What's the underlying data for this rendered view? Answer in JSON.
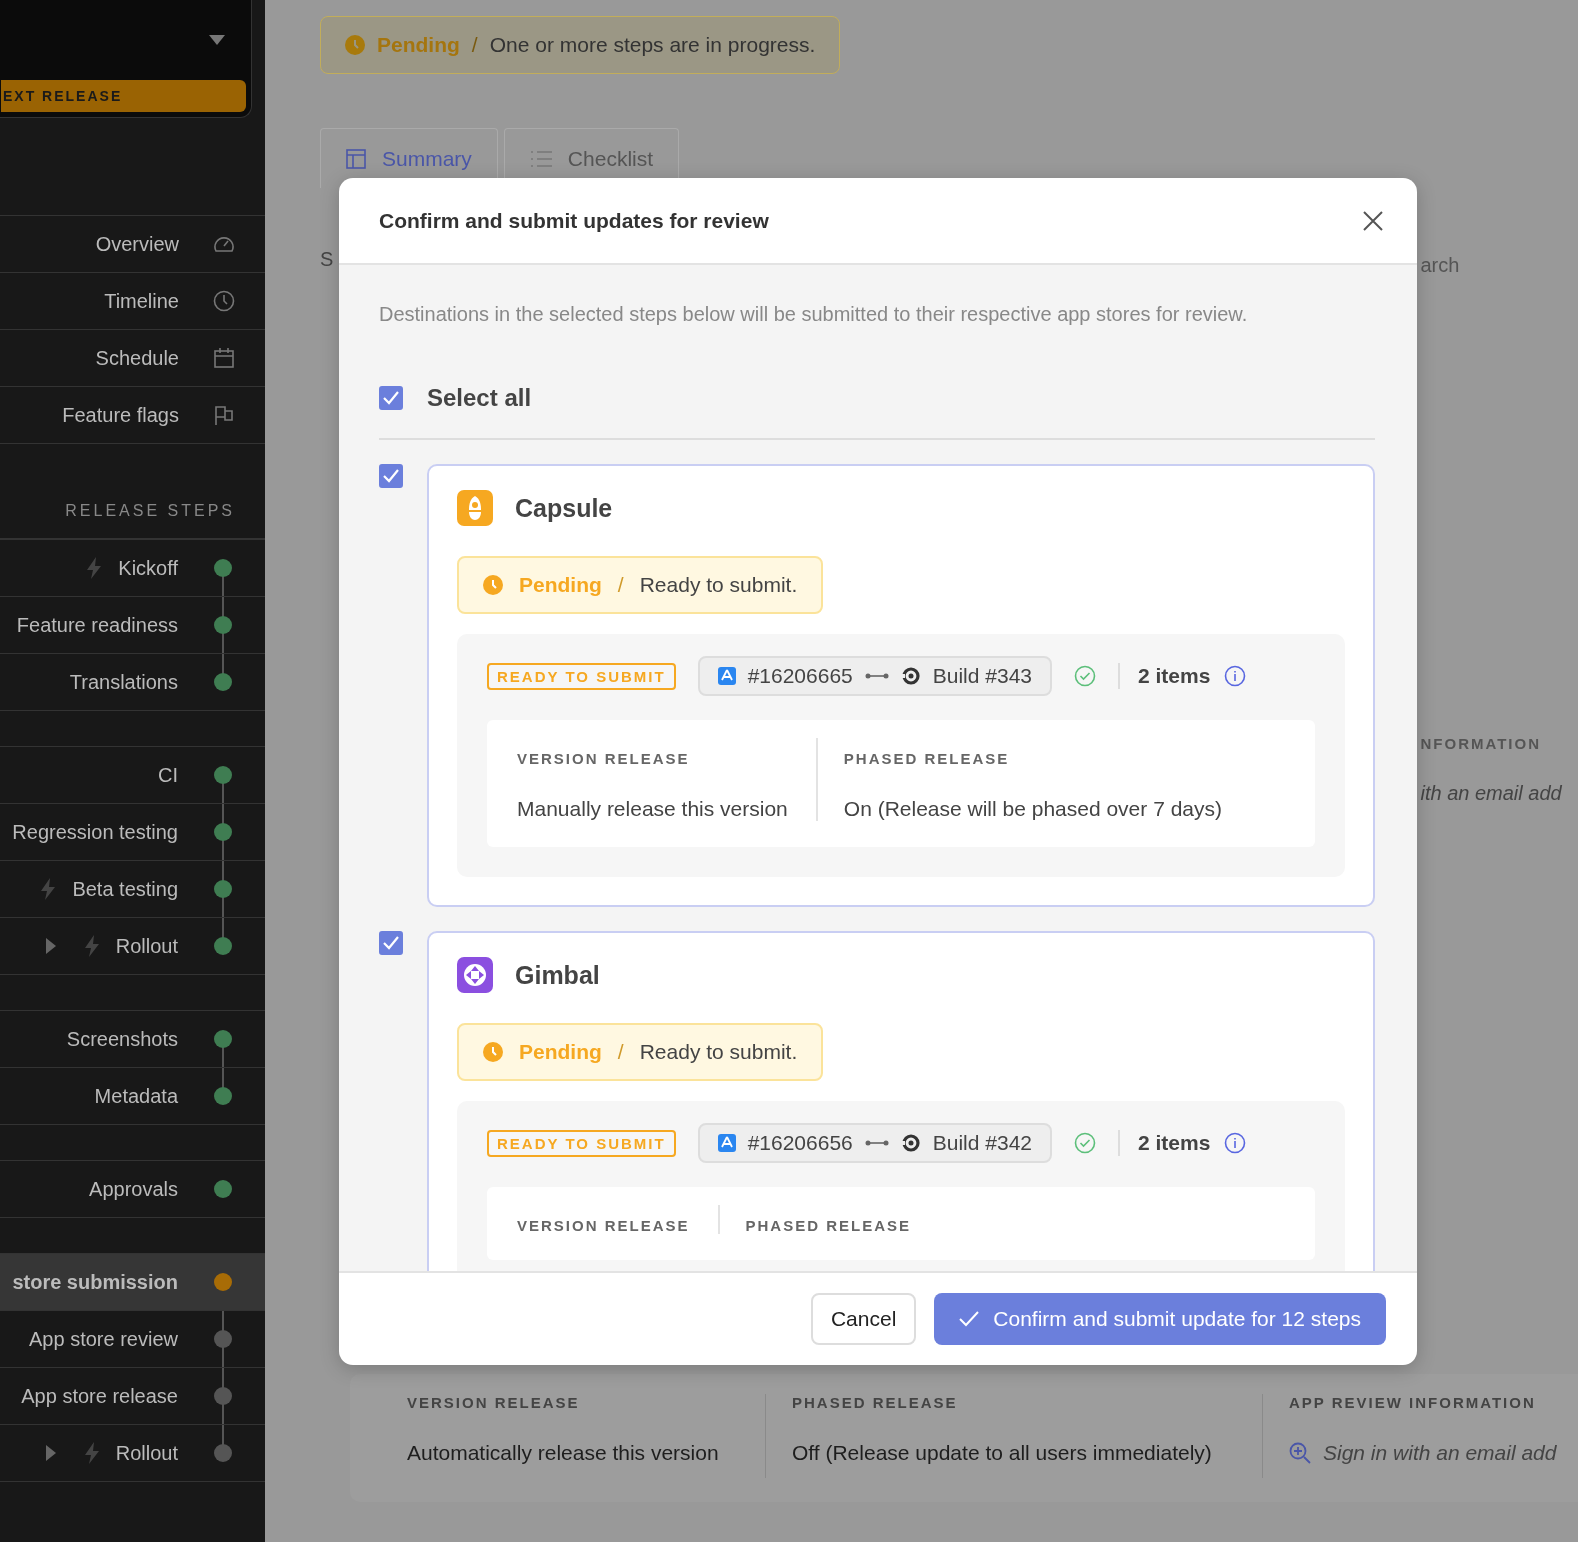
{
  "sidebar": {
    "release_label": "EXT RELEASE",
    "nav": [
      {
        "label": "Overview",
        "kind": "gauge"
      },
      {
        "label": "Timeline",
        "kind": "clock"
      },
      {
        "label": "Schedule",
        "kind": "calendar"
      },
      {
        "label": "Feature flags",
        "kind": "flag"
      }
    ],
    "steps_heading": "RELEASE STEPS",
    "step_groups": [
      {
        "steps": [
          {
            "label": "Kickoff",
            "automated": true,
            "expandable": false,
            "color": "#3f7d52",
            "selected": false
          },
          {
            "label": "Feature readiness",
            "automated": false,
            "expandable": false,
            "color": "#3f7d52",
            "selected": false
          },
          {
            "label": "Translations",
            "automated": false,
            "expandable": false,
            "color": "#3f7d52",
            "selected": false
          }
        ]
      },
      {
        "steps": [
          {
            "label": "CI",
            "automated": false,
            "expandable": false,
            "color": "#3f7d52",
            "selected": false
          },
          {
            "label": "Regression testing",
            "automated": false,
            "expandable": false,
            "color": "#3f7d52",
            "selected": false
          },
          {
            "label": "Beta testing",
            "automated": true,
            "expandable": false,
            "color": "#3f7d52",
            "selected": false
          },
          {
            "label": "Rollout",
            "automated": true,
            "expandable": true,
            "color": "#3f7d52",
            "selected": false
          }
        ]
      },
      {
        "steps": [
          {
            "label": "Screenshots",
            "automated": false,
            "expandable": false,
            "color": "#3f7d52",
            "selected": false
          },
          {
            "label": "Metadata",
            "automated": false,
            "expandable": false,
            "color": "#3f7d52",
            "selected": false
          }
        ]
      },
      {
        "steps": [
          {
            "label": "Approvals",
            "automated": false,
            "expandable": false,
            "color": "#3f7d52",
            "selected": false
          }
        ]
      },
      {
        "steps": [
          {
            "label": "store submission",
            "automated": false,
            "expandable": false,
            "color": "#a86c06",
            "selected": true
          },
          {
            "label": "App store review",
            "automated": false,
            "expandable": false,
            "color": "#555555",
            "selected": false
          },
          {
            "label": "App store release",
            "automated": false,
            "expandable": false,
            "color": "#555555",
            "selected": false
          },
          {
            "label": "Rollout",
            "automated": true,
            "expandable": true,
            "color": "#555555",
            "selected": false
          }
        ]
      }
    ]
  },
  "page": {
    "banner": {
      "status": "Pending",
      "separator": "/",
      "message": "One or more steps are in progress."
    },
    "tabs": [
      {
        "label": "Summary",
        "kind": "table",
        "selected": true
      },
      {
        "label": "Checklist",
        "kind": "list",
        "selected": false
      }
    ],
    "left_fragment": "S",
    "search_fragment": "arch",
    "info_heading_fragment": "NFORMATION",
    "info_value_fragment": "ith an email add",
    "bottom_fields": [
      {
        "label": "VERSION RELEASE",
        "value": "Automatically release this version",
        "kind": "text"
      },
      {
        "label": "PHASED RELEASE",
        "value": "Off (Release update to all users immediately)",
        "kind": "text"
      },
      {
        "label": "APP REVIEW INFORMATION",
        "value": "Sign in with an email add",
        "kind": "signin"
      }
    ]
  },
  "modal": {
    "title": "Confirm and submit updates for review",
    "description": "Destinations in the selected steps below will be submitted to their respective app stores for review.",
    "select_all": {
      "label": "Select all",
      "checked": true
    },
    "steps": [
      {
        "checked": true,
        "app": "Capsule",
        "kind": "capsule",
        "status": "Pending",
        "separator": "/",
        "message": "Ready to submit.",
        "tag": "READY TO SUBMIT",
        "submission": "#16206665",
        "build": "Build #343",
        "items": "2 items",
        "fields": [
          {
            "label": "VERSION RELEASE",
            "value": "Manually release this version"
          },
          {
            "label": "PHASED RELEASE",
            "value": "On (Release will be phased over 7 days)"
          }
        ]
      },
      {
        "checked": true,
        "app": "Gimbal",
        "kind": "gimbal",
        "status": "Pending",
        "separator": "/",
        "message": "Ready to submit.",
        "tag": "READY TO SUBMIT",
        "submission": "#16206656",
        "build": "Build #342",
        "items": "2 items",
        "fields": [
          {
            "label": "VERSION RELEASE"
          },
          {
            "label": "PHASED RELEASE"
          }
        ]
      }
    ],
    "buttons": {
      "cancel": "Cancel",
      "confirm": "Confirm and submit update for 12 steps"
    }
  }
}
